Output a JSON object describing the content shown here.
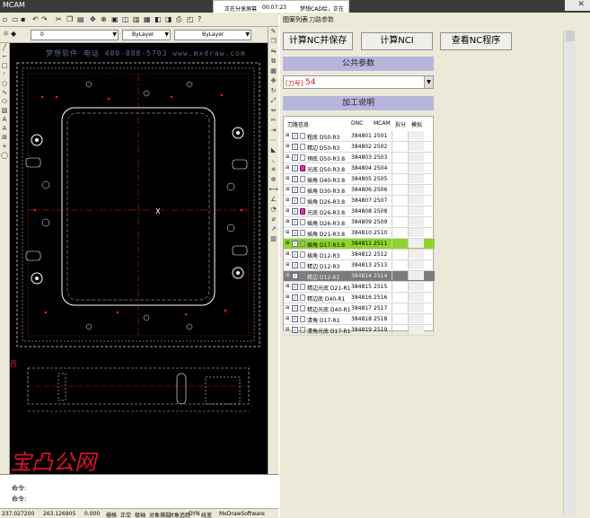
{
  "window": {
    "title": "MCAM"
  },
  "share_bar": {
    "status": "正在分享屏幕",
    "timer": "00:07:23",
    "message": "梦想CAD绘，正在讲解"
  },
  "cad": {
    "layer_combo": "0",
    "linetype_combo": "ByLayer",
    "lineweight_combo": "ByLayer",
    "watermark": "梦想软件  电话 400-888-5703  www.mxdraw.com",
    "toolbar_icons": [
      "new-icon",
      "open-icon",
      "save-icon",
      "undo-icon",
      "redo-icon"
    ],
    "red_text": "宝凸公网",
    "red_side_text": "西",
    "command_lines": [
      "命令:",
      "命令:"
    ],
    "status_values": [
      "237.027200",
      "263.126905",
      "0.000",
      "栅格",
      "正交",
      "极轴",
      "对象捕捉",
      "对象追踪",
      "DYN",
      "线宽",
      "MxDrawSoftware"
    ]
  },
  "panel": {
    "tabs": [
      "图案列表",
      "刀路参数"
    ],
    "buttons": {
      "compute_save": "计算NC并保存",
      "compute_nci": "计算NCI",
      "view_nc": "查看NC程序"
    },
    "public_params": {
      "title": "公共参数",
      "field_label": "[刀号]:",
      "field_value": "54"
    },
    "process": {
      "title": "加工说明",
      "headers": [
        "刀路信息",
        "DNC",
        "MCAM",
        "拆分",
        "模拟"
      ],
      "rows": [
        {
          "name": "粗底 D50-R3",
          "dnc": "384801",
          "mcam": "2501",
          "icon": "plain"
        },
        {
          "name": "精边 D50-R3",
          "dnc": "384802",
          "mcam": "2502",
          "icon": "plain"
        },
        {
          "name": "预底 D50-R3.8",
          "dnc": "384803",
          "mcam": "2503",
          "icon": "plain"
        },
        {
          "name": "光底 D50-R3.8",
          "dnc": "384804",
          "mcam": "2504",
          "icon": "purple"
        },
        {
          "name": "插角 D40-R3.8",
          "dnc": "384805",
          "mcam": "2505",
          "icon": "plain"
        },
        {
          "name": "插角 D30-R3.8",
          "dnc": "384806",
          "mcam": "2506",
          "icon": "plain"
        },
        {
          "name": "插角 D26-R3.8",
          "dnc": "384807",
          "mcam": "2507",
          "icon": "plain"
        },
        {
          "name": "光底 D26-R3.8",
          "dnc": "384808",
          "mcam": "2508",
          "icon": "purple"
        },
        {
          "name": "插角 D26-R3.8",
          "dnc": "384809",
          "mcam": "2509",
          "icon": "plain"
        },
        {
          "name": "插角 D21-R3.8",
          "dnc": "384810",
          "mcam": "2510",
          "icon": "plain"
        },
        {
          "name": "插角 D17-R3.8",
          "dnc": "384811",
          "mcam": "2511",
          "icon": "plain",
          "state": "selected-green"
        },
        {
          "name": "插角 D12-R3",
          "dnc": "384812",
          "mcam": "2512",
          "icon": "plain"
        },
        {
          "name": "精边 D12-R3",
          "dnc": "384813",
          "mcam": "2513",
          "icon": "plain"
        },
        {
          "name": "精边 D12-R1",
          "dnc": "384814",
          "mcam": "2514",
          "icon": "plain",
          "state": "selected-gray"
        },
        {
          "name": "精边光底 D21-R1",
          "dnc": "384815",
          "mcam": "2515",
          "icon": "plain"
        },
        {
          "name": "精边底 D40-R1",
          "dnc": "384816",
          "mcam": "2516",
          "icon": "plain"
        },
        {
          "name": "精边光底 D40-R1",
          "dnc": "384817",
          "mcam": "2517",
          "icon": "plain"
        },
        {
          "name": "清角 D17-R1",
          "dnc": "384818",
          "mcam": "2518",
          "icon": "plain"
        },
        {
          "name": "清角光底 D17-R1",
          "dnc": "384819",
          "mcam": "2519",
          "icon": "plain"
        }
      ]
    }
  },
  "colors": {
    "selected_green": "#8fd42c",
    "selected_gray": "#7b7b7b",
    "section_header": "#b8b5dc",
    "cad_background": "#000000",
    "cad_red_text": "#e0102a"
  }
}
